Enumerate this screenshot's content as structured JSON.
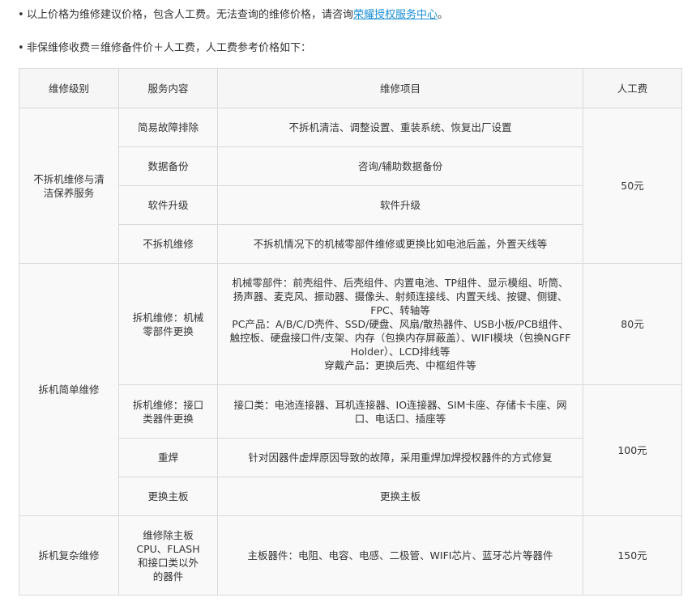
{
  "notes": {
    "line1_prefix": "以上价格为维修建议价格，包含人工费。无法查询的维修价格，请咨询",
    "line1_link": "荣耀授权服务中心",
    "line1_suffix": "。",
    "line2": "非保维修收费＝维修备件价＋人工费，人工费参考价格如下："
  },
  "table": {
    "headers": [
      "维修级别",
      "服务内容",
      "维修项目",
      "人工费"
    ],
    "groups": [
      {
        "level": "不拆机维修与清洁保养服务",
        "rows": [
          {
            "service": "简易故障排除",
            "items": [
              "不拆机清洁、调整设置、重装系统、恢复出厂设置"
            ]
          },
          {
            "service": "数据备份",
            "items": [
              "咨询/辅助数据备份"
            ]
          },
          {
            "service": "软件升级",
            "items": [
              "软件升级"
            ]
          },
          {
            "service": "不拆机维修",
            "items": [
              "不拆机情况下的机械零部件维修或更换比如电池后盖，外置天线等"
            ]
          }
        ],
        "fees": [
          "50元"
        ]
      },
      {
        "level": "拆机简单维修",
        "rows": [
          {
            "service": "拆机维修：机械零部件更换",
            "items": [
              "机械零部件：前壳组件、后壳组件、内置电池、TP组件、显示模组、听筒、扬声器、麦克风、振动器、摄像头、射频连接线、内置天线、按键、侧键、FPC、转轴等",
              "PC产品：A/B/C/D壳件、SSD/硬盘、风扇/散热器件、USB小板/PCB组件、触控板、硬盘接口件/支架、内存（包换内存屏蔽盖）、WIFI模块（包换NGFF Holder）、LCD排线等",
              "穿戴产品：更换后壳、中框组件等"
            ]
          },
          {
            "service": "拆机维修：接口类器件更换",
            "items": [
              "接口类：电池连接器、耳机连接器、IO连接器、SIM卡座、存储卡卡座、网口、电话口、插座等"
            ]
          },
          {
            "service": "重焊",
            "items": [
              "针对因器件虚焊原因导致的故障，采用重焊加焊授权器件的方式修复"
            ]
          },
          {
            "service": "更换主板",
            "items": [
              "更换主板"
            ]
          }
        ],
        "fees": [
          "80元",
          "100元"
        ]
      },
      {
        "level": "拆机复杂维修",
        "rows": [
          {
            "service": "维修除主板CPU、FLASH和接口类以外的器件",
            "items": [
              "主板器件：电阻、电容、电感、二极管、WIFI芯片、蓝牙芯片等器件"
            ]
          }
        ],
        "fees": [
          "150元"
        ]
      }
    ]
  }
}
